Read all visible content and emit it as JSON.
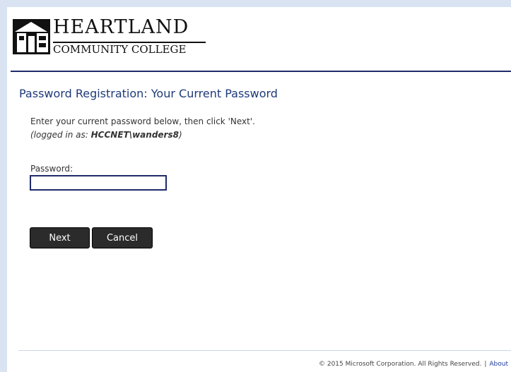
{
  "logo": {
    "line1": "HEARTLAND",
    "line2": "COMMUNITY COLLEGE"
  },
  "page": {
    "title": "Password Registration:  Your Current Password",
    "instructions": "Enter your current password below, then click 'Next'.",
    "logged_in_prefix": "(logged in as: ",
    "logged_in_user": "HCCNET\\wanders8",
    "logged_in_suffix": ")"
  },
  "form": {
    "password_label": "Password:",
    "password_value": ""
  },
  "buttons": {
    "next": "Next",
    "cancel": "Cancel"
  },
  "footer": {
    "copyright": "© 2015 Microsoft Corporation. All Rights Reserved.",
    "separator": "|",
    "about": "About"
  },
  "colors": {
    "accent": "#1f2a6a",
    "title": "#1f3a7a",
    "button": "#2b2b2b",
    "background": "#d9e3f1"
  }
}
